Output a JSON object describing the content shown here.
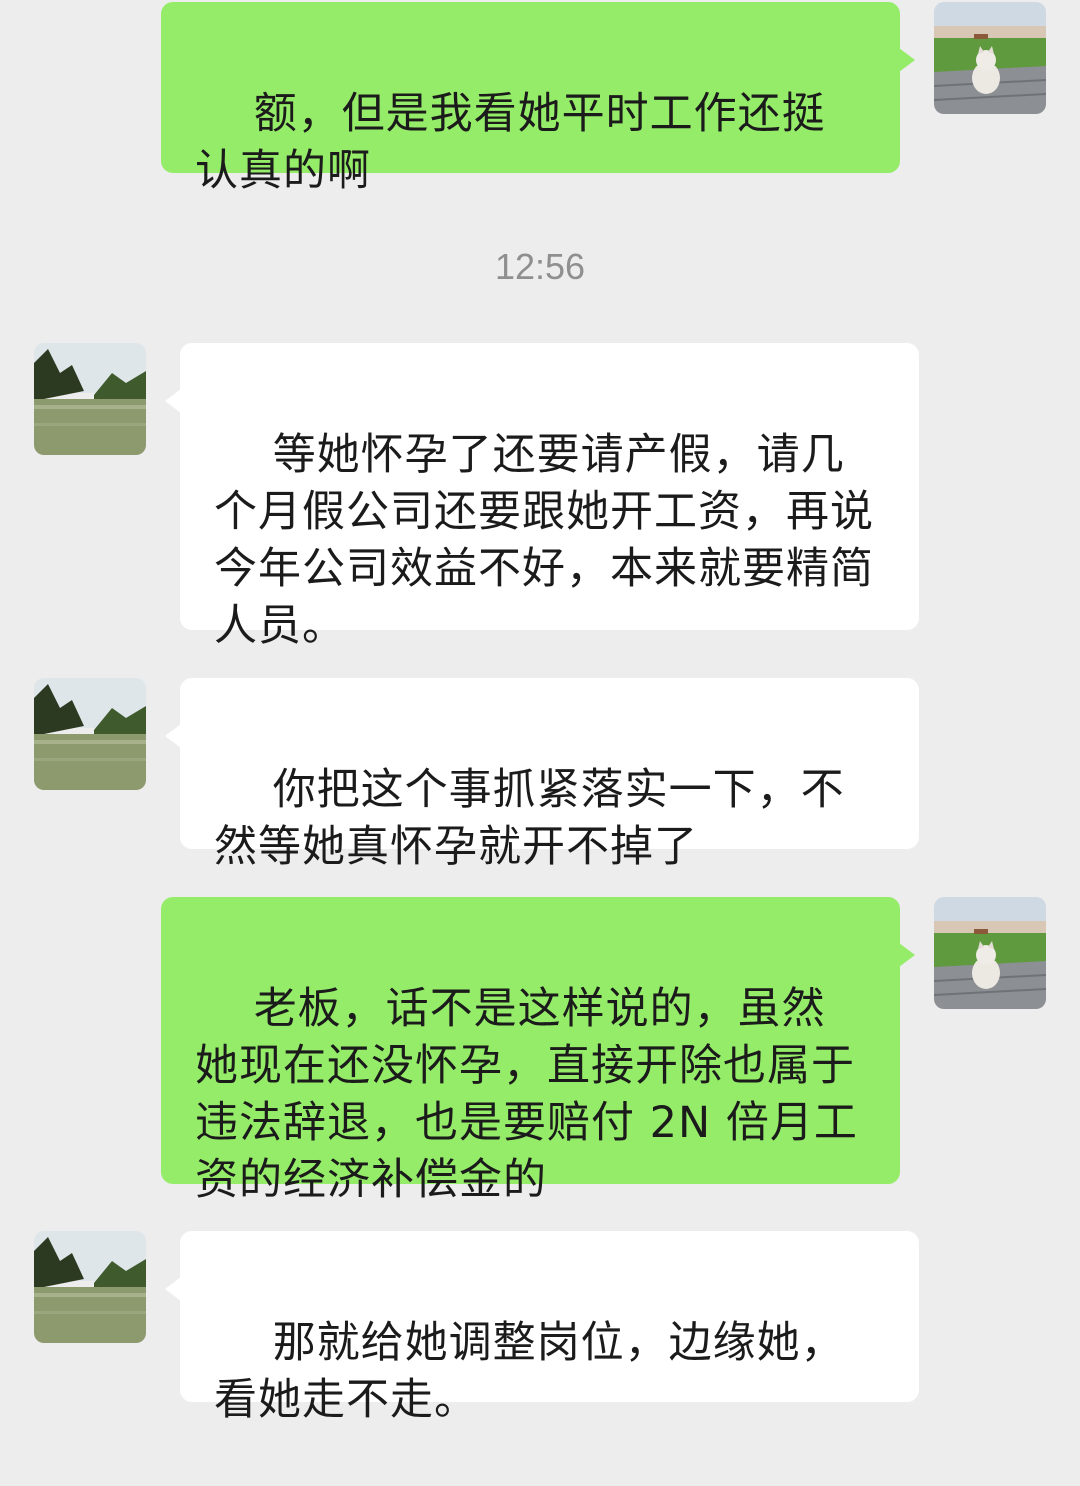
{
  "chat": {
    "timestamp": "12:56",
    "messages": [
      {
        "side": "out",
        "text": "额，但是我看她平时工作还挺认真的啊"
      },
      {
        "side": "in",
        "text": "等她怀孕了还要请产假，请几个月假公司还要跟她开工资，再说今年公司效益不好，本来就要精简人员。"
      },
      {
        "side": "in",
        "text": "你把这个事抓紧落实一下，不然等她真怀孕就开不掉了"
      },
      {
        "side": "out",
        "text": "老板，话不是这样说的，虽然她现在还没怀孕，直接开除也属于违法辞退，也是要赔付 2N 倍月工资的经济补偿金的"
      },
      {
        "side": "in",
        "text": "那就给她调整岗位，边缘她，看她走不走。"
      }
    ]
  },
  "colors": {
    "background": "#ededed",
    "outgoing_bubble": "#95ec69",
    "incoming_bubble": "#ffffff",
    "text": "#1b1b1b",
    "timestamp": "#8f8f8f"
  },
  "icons": {
    "self_avatar": "cat-on-deck-avatar",
    "contact_avatar": "lake-landscape-avatar"
  }
}
